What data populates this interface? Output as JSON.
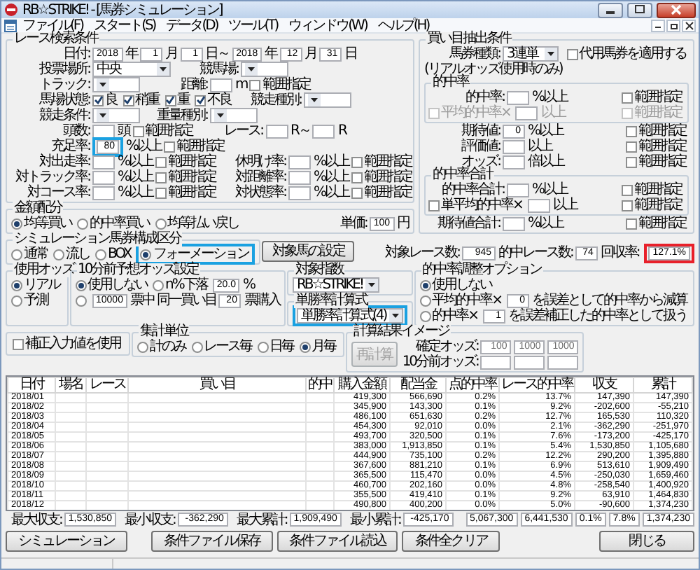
{
  "window": {
    "title": "RB☆STRIKE! - [馬券シミュレーション]"
  },
  "menu": [
    "ファイル(F)",
    "スタート(S)",
    "データ(D)",
    "ツール(T)",
    "ウィンドウ(W)",
    "ヘルプ(H)"
  ],
  "race_conditions": {
    "title": "レース検索条件",
    "rows": [
      {
        "label": "日付:",
        "items": [
          {
            "kind": "field",
            "value": "2018"
          },
          {
            "kind": "text",
            "text": "年"
          },
          {
            "kind": "field",
            "value": "1"
          },
          {
            "kind": "text",
            "text": "月"
          },
          {
            "kind": "field",
            "value": "1"
          },
          {
            "kind": "text",
            "text": "日～"
          },
          {
            "kind": "field",
            "value": "2018"
          },
          {
            "kind": "text",
            "text": "年"
          },
          {
            "kind": "field",
            "value": "12"
          },
          {
            "kind": "text",
            "text": "月"
          },
          {
            "kind": "field",
            "value": "31"
          },
          {
            "kind": "text",
            "text": "日"
          }
        ]
      },
      {
        "label": "投票場所:",
        "items": [
          {
            "kind": "select",
            "value": "中央"
          },
          {
            "kind": "label",
            "text": "競馬場:"
          },
          {
            "kind": "select"
          }
        ]
      },
      {
        "label": "トラック:",
        "items": [
          {
            "kind": "select"
          },
          {
            "kind": "label",
            "text": "距離:"
          },
          {
            "kind": "field"
          },
          {
            "kind": "text",
            "text": "m"
          },
          {
            "kind": "check",
            "label": "範囲指定",
            "checked": false
          }
        ]
      },
      {
        "label": "馬場状態:",
        "items": [
          {
            "kind": "check",
            "label": "良",
            "checked": true
          },
          {
            "kind": "check",
            "label": "稍重",
            "checked": true
          },
          {
            "kind": "check",
            "label": "重",
            "checked": true
          },
          {
            "kind": "check",
            "label": "不良",
            "checked": true
          },
          {
            "kind": "label",
            "text": "競走種別:"
          },
          {
            "kind": "select"
          }
        ]
      },
      {
        "label": "競走条件:",
        "items": [
          {
            "kind": "select"
          },
          {
            "kind": "label",
            "text": "重量種別:"
          },
          {
            "kind": "select"
          }
        ]
      },
      {
        "label": "頭数:",
        "items": [
          {
            "kind": "field"
          },
          {
            "kind": "text",
            "text": "頭"
          },
          {
            "kind": "check",
            "label": "範囲指定",
            "checked": false
          },
          {
            "kind": "label",
            "text": "レース:"
          },
          {
            "kind": "field"
          },
          {
            "kind": "text",
            "text": "R～"
          },
          {
            "kind": "field"
          },
          {
            "kind": "text",
            "text": "R"
          }
        ]
      },
      {
        "label": "充足率:",
        "items": [
          {
            "kind": "field",
            "value": "80",
            "color": "#1aa1e1"
          },
          {
            "kind": "text",
            "text": "%以上"
          },
          {
            "kind": "check",
            "label": "範囲指定",
            "checked": false
          }
        ]
      },
      {
        "label": "対出走率:",
        "items": [
          {
            "kind": "field"
          },
          {
            "kind": "text",
            "text": "%以上"
          },
          {
            "kind": "check",
            "label": "範囲指定",
            "checked": false
          },
          {
            "kind": "label",
            "text": "休明け率:"
          },
          {
            "kind": "field"
          },
          {
            "kind": "text",
            "text": "%以上"
          },
          {
            "kind": "check",
            "label": "範囲指定",
            "checked": false
          }
        ]
      },
      {
        "label": "対トラック率:",
        "items": [
          {
            "kind": "field"
          },
          {
            "kind": "text",
            "text": "%以上"
          },
          {
            "kind": "check",
            "label": "範囲指定",
            "checked": false
          },
          {
            "kind": "label",
            "text": "対距離率:"
          },
          {
            "kind": "field"
          },
          {
            "kind": "text",
            "text": "%以上"
          },
          {
            "kind": "check",
            "label": "範囲指定",
            "checked": false
          }
        ]
      },
      {
        "label": "対コース率:",
        "items": [
          {
            "kind": "field"
          },
          {
            "kind": "text",
            "text": "%以上"
          },
          {
            "kind": "check",
            "label": "範囲指定",
            "checked": false
          },
          {
            "kind": "label",
            "text": "対状態率:"
          },
          {
            "kind": "field"
          },
          {
            "kind": "text",
            "text": "%以上"
          },
          {
            "kind": "check",
            "label": "範囲指定",
            "checked": false
          }
        ]
      }
    ]
  },
  "money_allocation": {
    "title": "金額配分",
    "items": [
      {
        "kind": "radio",
        "label": "均等買い",
        "selected": true
      },
      {
        "kind": "radio",
        "label": "的中率買い",
        "selected": false
      },
      {
        "kind": "radio",
        "label": "均等払い戻し",
        "selected": false
      },
      {
        "kind": "label",
        "text": "単価:"
      },
      {
        "kind": "field",
        "value": "100"
      },
      {
        "kind": "text",
        "text": "円"
      }
    ]
  },
  "bet_conditions": {
    "title": "買い目抽出条件",
    "sections": [
      {
        "kind": "row",
        "items": [
          {
            "kind": "label",
            "text": "馬券種類:"
          },
          {
            "kind": "select",
            "value": "3連単"
          },
          {
            "kind": "check",
            "label": "代用馬券を適用する",
            "checked": false
          }
        ]
      },
      {
        "kind": "row",
        "items": [
          {
            "kind": "text",
            "text": "(リアルオッズ使用時のみ)"
          }
        ]
      },
      {
        "kind": "subgroup",
        "title": "的中率",
        "rows": [
          {
            "disabled": false,
            "items": [
              {
                "kind": "label",
                "text": "的中率:"
              },
              {
                "kind": "field"
              },
              {
                "kind": "text",
                "text": "%以上"
              },
              {
                "kind": "check",
                "label": "範囲指定",
                "checked": false
              }
            ]
          },
          {
            "disabled": true,
            "items": [
              {
                "kind": "check",
                "label": "平均的中率×",
                "checked": false
              },
              {
                "kind": "field"
              },
              {
                "kind": "text",
                "text": "以上"
              },
              {
                "kind": "check",
                "label": "範囲指定",
                "checked": false
              }
            ]
          }
        ]
      },
      {
        "kind": "row",
        "items": [
          {
            "kind": "label",
            "text": "期待値:"
          },
          {
            "kind": "field",
            "value": "0"
          },
          {
            "kind": "text",
            "text": "%以上"
          },
          {
            "kind": "check",
            "label": "範囲指定",
            "checked": false
          }
        ]
      },
      {
        "kind": "row",
        "items": [
          {
            "kind": "label",
            "text": "評価値:"
          },
          {
            "kind": "field"
          },
          {
            "kind": "text",
            "text": "以上"
          },
          {
            "kind": "check",
            "label": "範囲指定",
            "checked": false
          }
        ]
      },
      {
        "kind": "row",
        "items": [
          {
            "kind": "label",
            "text": "オッズ:"
          },
          {
            "kind": "field"
          },
          {
            "kind": "text",
            "text": "倍以上"
          },
          {
            "kind": "check",
            "label": "範囲指定",
            "checked": false
          }
        ]
      },
      {
        "kind": "subgroup",
        "title": "的中率合計",
        "rows": [
          {
            "disabled": false,
            "items": [
              {
                "kind": "label",
                "text": "的中率合計:"
              },
              {
                "kind": "field"
              },
              {
                "kind": "text",
                "text": "%以上"
              },
              {
                "kind": "check",
                "label": "範囲指定",
                "checked": false
              }
            ]
          },
          {
            "disabled": false,
            "items": [
              {
                "kind": "check",
                "label": "単平均的中率×",
                "checked": false
              },
              {
                "kind": "field"
              },
              {
                "kind": "text",
                "text": "以上"
              },
              {
                "kind": "check",
                "label": "範囲指定",
                "checked": false
              }
            ]
          }
        ]
      },
      {
        "kind": "row",
        "items": [
          {
            "kind": "label",
            "text": "期待値合計:"
          },
          {
            "kind": "field"
          },
          {
            "kind": "text",
            "text": "%以上"
          },
          {
            "kind": "check",
            "label": "範囲指定",
            "checked": false
          }
        ]
      }
    ]
  },
  "sim_type": {
    "title": "シミュレーション馬券構成区分",
    "options": [
      {
        "label": "通常",
        "selected": false
      },
      {
        "label": "流し",
        "selected": false
      },
      {
        "label": "BOX",
        "selected": false
      },
      {
        "label": "フォーメーション",
        "selected": true,
        "color": "#1aa1e1"
      }
    ]
  },
  "target_button": {
    "label": "対象馬の設定"
  },
  "counts": [
    {
      "label": "対象レース数:",
      "value": "945"
    },
    {
      "label": "的中レース数:",
      "value": "74"
    },
    {
      "label": "回収率:",
      "value": "127.1%",
      "color": "#e8202a"
    }
  ],
  "odds_used": {
    "title": "使用オッズ",
    "options": [
      {
        "label": "リアル",
        "selected": true
      },
      {
        "label": "予測",
        "selected": false
      }
    ]
  },
  "pre_odds": {
    "title": "10分前予想オッズ設定",
    "rows": [
      {
        "items": [
          {
            "kind": "radio",
            "label": "使用しない",
            "selected": true
          },
          {
            "kind": "radio",
            "label": "n%下落",
            "selected": false
          },
          {
            "kind": "field",
            "value": "20.0"
          },
          {
            "kind": "text",
            "text": "%"
          }
        ]
      },
      {
        "items": [
          {
            "kind": "radio",
            "selected": false
          },
          {
            "kind": "field",
            "value": "10000"
          },
          {
            "kind": "text",
            "text": "票中"
          },
          {
            "kind": "text",
            "text": "同一買い目"
          },
          {
            "kind": "field",
            "value": "20"
          },
          {
            "kind": "text",
            "text": "票購入"
          }
        ]
      }
    ]
  },
  "target_index": {
    "title": "対象指数",
    "value": "RB☆STRIKE!"
  },
  "win_formula": {
    "title": "単勝率計算式",
    "value": "単勝率計算式(4)",
    "color": "#1aa1e1"
  },
  "hit_adjust": {
    "title": "的中率調整オプション",
    "rows": [
      {
        "items": [
          {
            "kind": "radio",
            "label": "使用しない",
            "selected": true
          }
        ]
      },
      {
        "items": [
          {
            "kind": "radio",
            "label": "平均的中率×",
            "selected": false
          },
          {
            "kind": "field",
            "value": "0"
          },
          {
            "kind": "text",
            "text": "を誤差として的中率から減算"
          }
        ]
      },
      {
        "items": [
          {
            "kind": "radio",
            "label": "的中率×",
            "selected": false
          },
          {
            "kind": "field",
            "value": "1"
          },
          {
            "kind": "text",
            "text": "を誤差補正した的中率として扱う"
          }
        ]
      }
    ]
  },
  "correction": {
    "label": "補正入力値を使用",
    "checked": false
  },
  "aggregate": {
    "title": "集計単位",
    "options": [
      {
        "label": "計のみ",
        "selected": false
      },
      {
        "label": "レース毎",
        "selected": false
      },
      {
        "label": "日毎",
        "selected": false
      },
      {
        "label": "月毎",
        "selected": true
      }
    ]
  },
  "calc_image": {
    "title": "計算結果イメージ",
    "button": {
      "label": "再計算",
      "disabled": true
    },
    "rows": [
      {
        "label": "確定オッズ:",
        "items": [
          {
            "kind": "field",
            "value": "100"
          },
          {
            "kind": "field",
            "value": "1000"
          },
          {
            "kind": "field",
            "value": "1000"
          }
        ]
      },
      {
        "label": "10分前オッズ:",
        "items": [
          {
            "kind": "field"
          },
          {
            "kind": "field"
          },
          {
            "kind": "field"
          }
        ]
      }
    ]
  },
  "table": {
    "columns": [
      "日付",
      "場名",
      "レース",
      "買い目",
      "的中",
      "購入金額",
      "配当金",
      "点的中率",
      "レース的中率",
      "収支",
      "累計"
    ],
    "rows": [
      {
        "date": "2018/01",
        "amount": "419,300",
        "payout": "566,690",
        "point_rate": "0.2%",
        "race_rate": "13.7%",
        "balance": "147,390",
        "total": "147,390"
      },
      {
        "date": "2018/02",
        "amount": "345,900",
        "payout": "143,300",
        "point_rate": "0.1%",
        "race_rate": "9.2%",
        "balance": "-202,600",
        "total": "-55,210"
      },
      {
        "date": "2018/03",
        "amount": "486,100",
        "payout": "651,630",
        "point_rate": "0.2%",
        "race_rate": "12.7%",
        "balance": "165,530",
        "total": "110,320"
      },
      {
        "date": "2018/04",
        "amount": "454,300",
        "payout": "92,010",
        "point_rate": "0.0%",
        "race_rate": "2.1%",
        "balance": "-362,290",
        "total": "-251,970"
      },
      {
        "date": "2018/05",
        "amount": "493,700",
        "payout": "320,500",
        "point_rate": "0.1%",
        "race_rate": "7.6%",
        "balance": "-173,200",
        "total": "-425,170"
      },
      {
        "date": "2018/06",
        "amount": "383,000",
        "payout": "1,913,850",
        "point_rate": "0.1%",
        "race_rate": "5.4%",
        "balance": "1,530,850",
        "total": "1,105,680"
      },
      {
        "date": "2018/07",
        "amount": "444,900",
        "payout": "735,100",
        "point_rate": "0.2%",
        "race_rate": "12.2%",
        "balance": "290,200",
        "total": "1,395,880"
      },
      {
        "date": "2018/08",
        "amount": "367,600",
        "payout": "881,210",
        "point_rate": "0.1%",
        "race_rate": "6.9%",
        "balance": "513,610",
        "total": "1,909,490"
      },
      {
        "date": "2018/09",
        "amount": "365,500",
        "payout": "115,470",
        "point_rate": "0.0%",
        "race_rate": "4.5%",
        "balance": "-250,030",
        "total": "1,659,460"
      },
      {
        "date": "2018/10",
        "amount": "460,700",
        "payout": "202,160",
        "point_rate": "0.0%",
        "race_rate": "4.8%",
        "balance": "-258,540",
        "total": "1,400,920"
      },
      {
        "date": "2018/11",
        "amount": "355,500",
        "payout": "419,410",
        "point_rate": "0.1%",
        "race_rate": "9.2%",
        "balance": "63,910",
        "total": "1,464,830"
      },
      {
        "date": "2018/12",
        "amount": "490,800",
        "payout": "400,200",
        "point_rate": "0.0%",
        "race_rate": "5.0%",
        "balance": "-90,600",
        "total": "1,374,230"
      }
    ]
  },
  "summary": {
    "stats": [
      {
        "label": "最大収支:",
        "value": "1,530,850"
      },
      {
        "label": "最小収支:",
        "value": "-362,290"
      },
      {
        "label": "最大累計:",
        "value": "1,909,490"
      },
      {
        "label": "最小累計:",
        "value": "-425,170"
      }
    ],
    "totals": [
      "5,067,300",
      "6,441,530",
      "0.1%",
      "7.8%",
      "1,374,230"
    ]
  },
  "buttons": [
    {
      "label": "シミュレーション"
    },
    {
      "label": "条件ファイル保存"
    },
    {
      "label": "条件ファイル読込"
    },
    {
      "label": "条件全クリア"
    }
  ],
  "close_button": {
    "label": "閉じる"
  }
}
